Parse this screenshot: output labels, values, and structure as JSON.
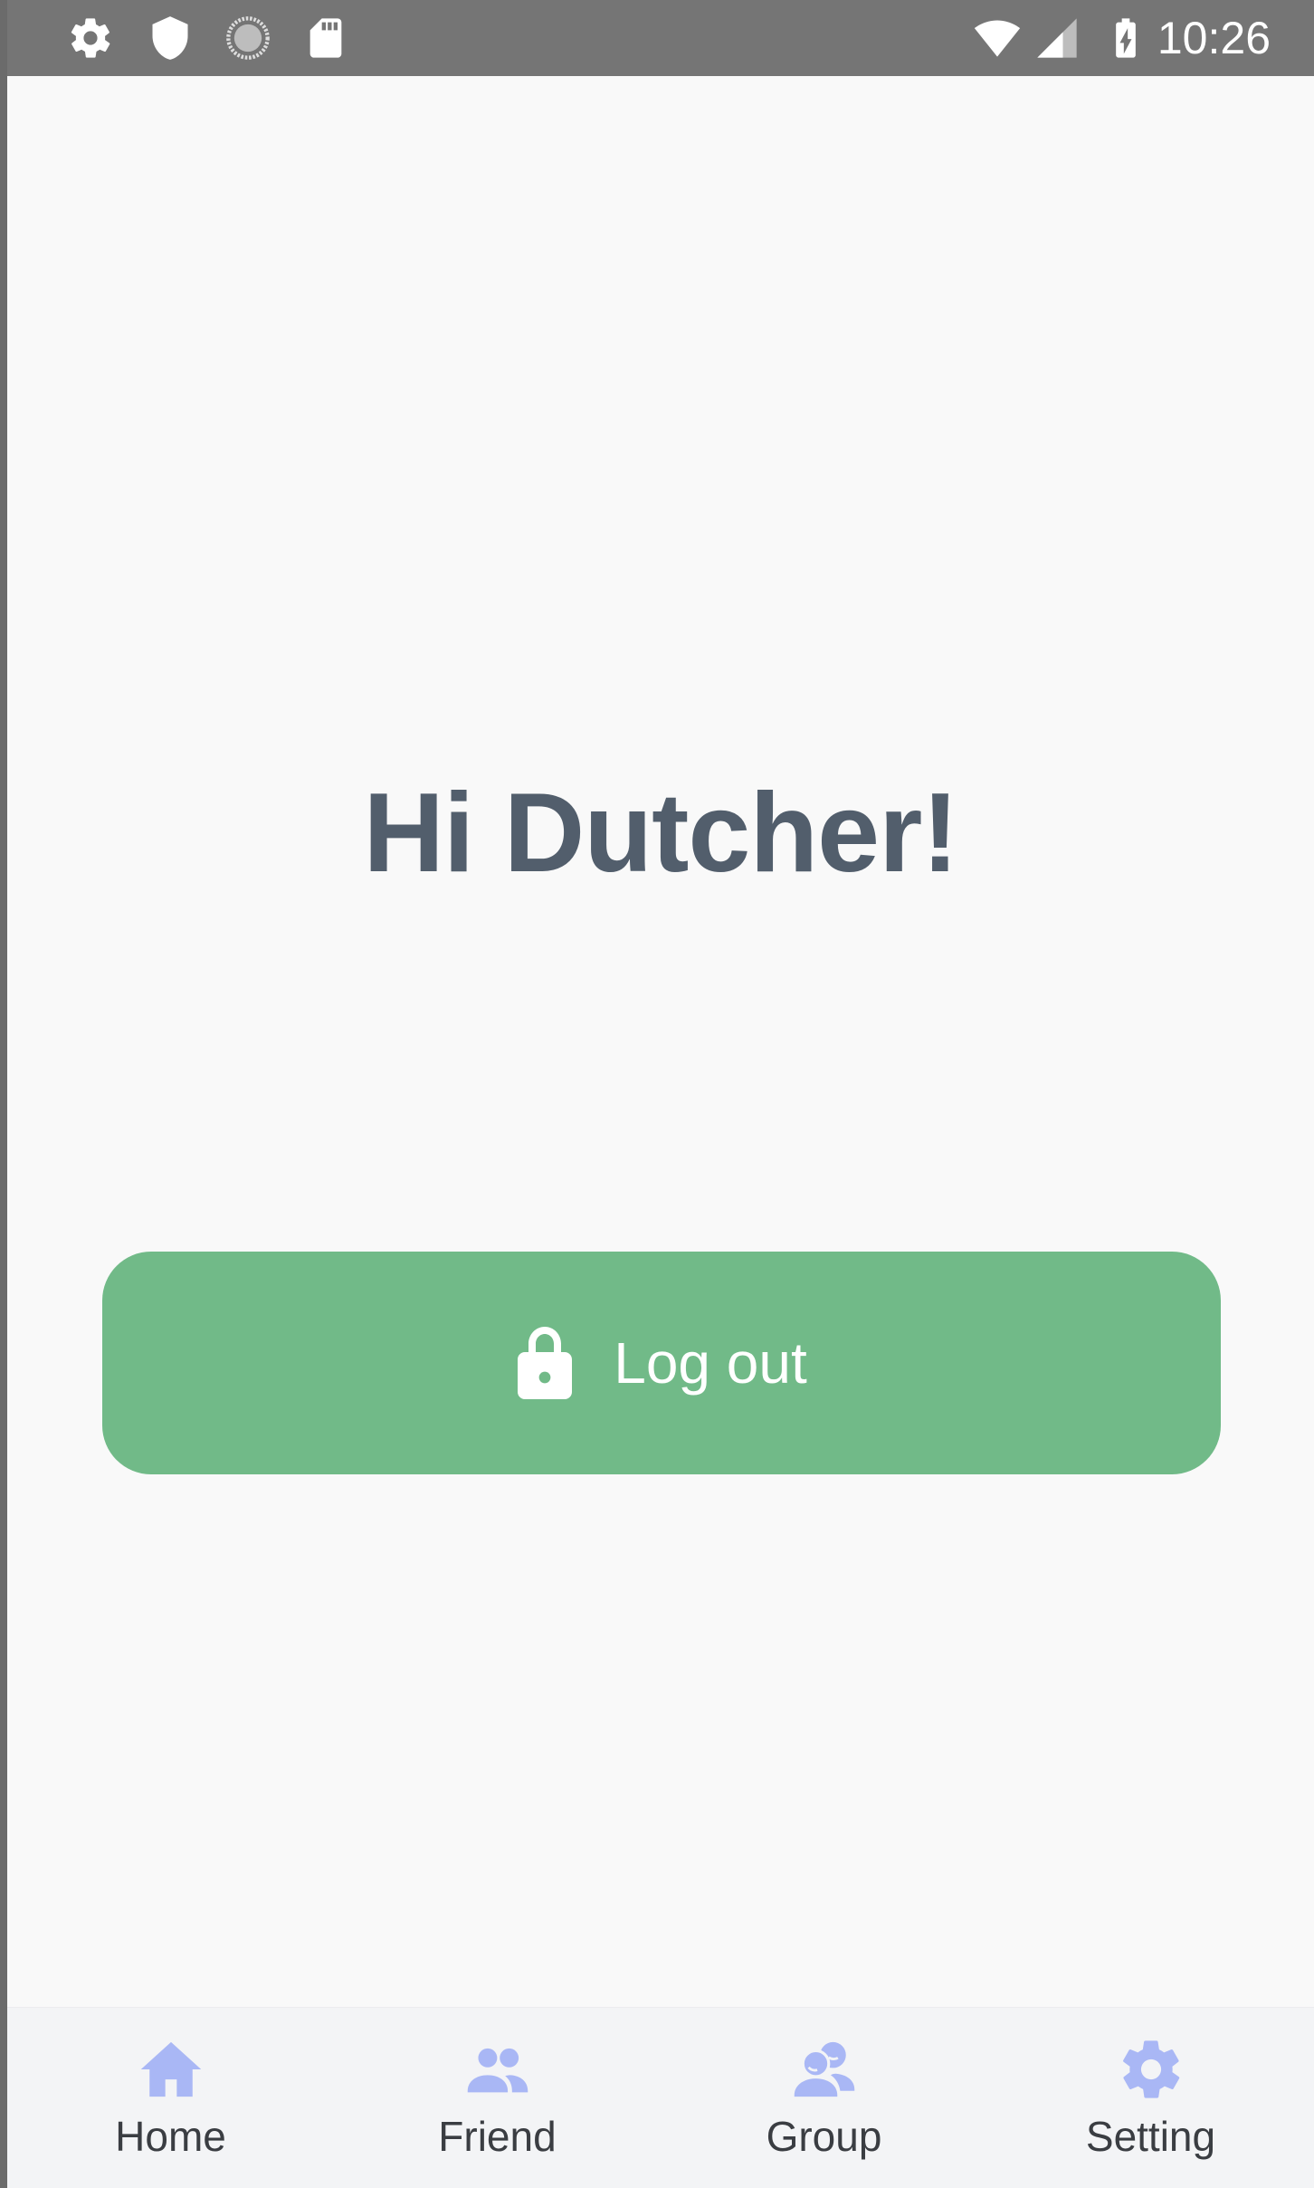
{
  "status_bar": {
    "time": "10:26",
    "left_icons": [
      "settings-icon",
      "shield-icon",
      "sync-icon",
      "sd-card-icon"
    ],
    "right_icons": [
      "wifi-icon",
      "cellular-signal-icon",
      "battery-charging-icon"
    ]
  },
  "main": {
    "greeting": "Hi Dutcher!",
    "logout_button": {
      "label": "Log out",
      "icon": "lock-icon",
      "color": "#71ba88"
    }
  },
  "bottom_nav": {
    "accent_color": "#a9b7f5",
    "items": [
      {
        "label": "Home",
        "icon": "home-icon"
      },
      {
        "label": "Friend",
        "icon": "friends-icon"
      },
      {
        "label": "Group",
        "icon": "group-icon"
      },
      {
        "label": "Setting",
        "icon": "gear-icon"
      }
    ]
  }
}
